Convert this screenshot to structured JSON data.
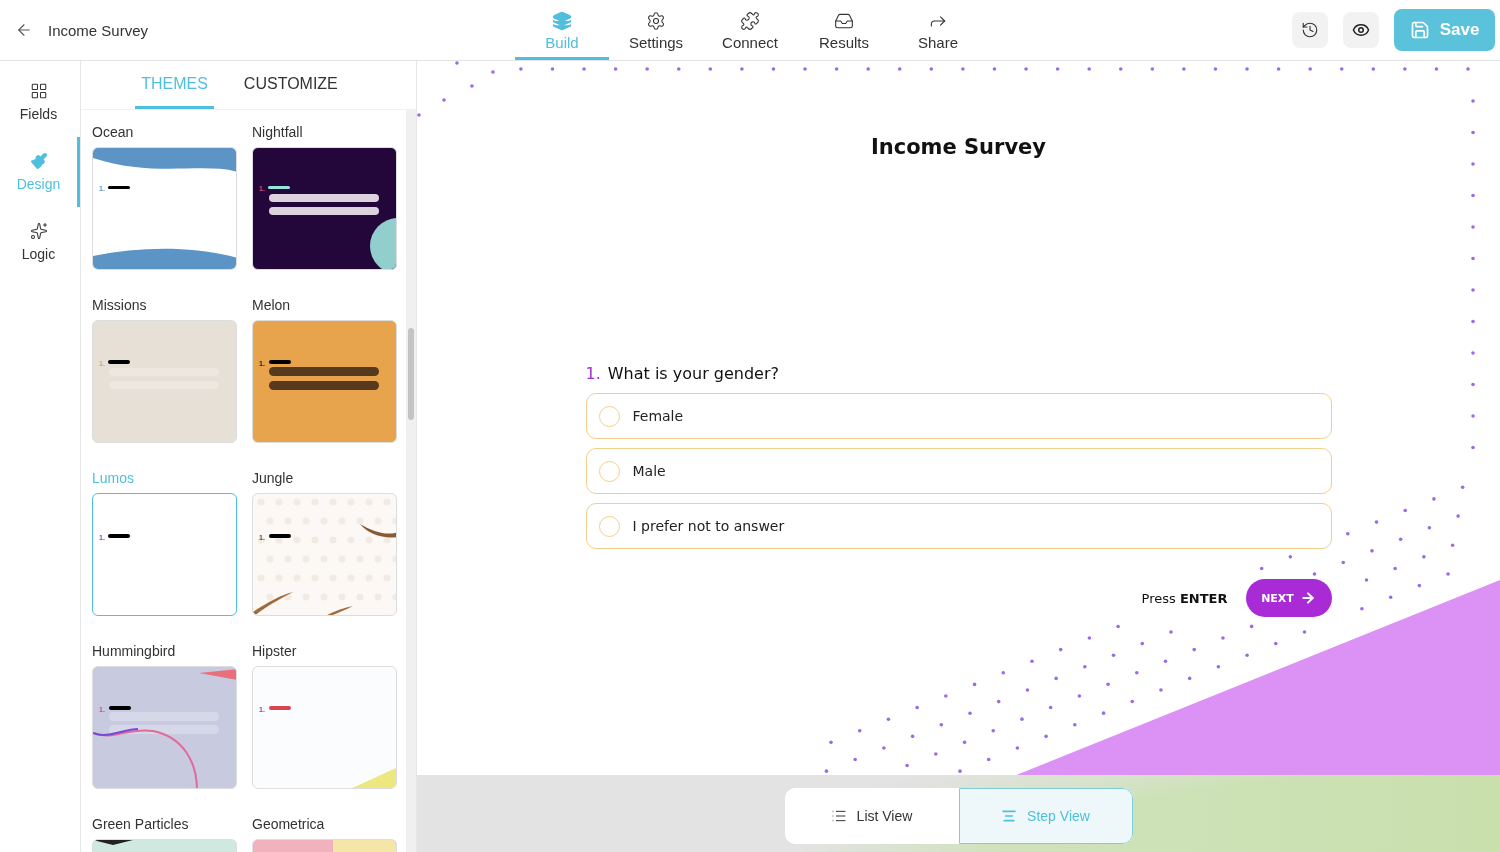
{
  "topbar": {
    "title": "Income Survey",
    "save_label": "Save"
  },
  "nav_tabs": [
    {
      "label": "Build",
      "selected": true
    },
    {
      "label": "Settings",
      "selected": false
    },
    {
      "label": "Connect",
      "selected": false
    },
    {
      "label": "Results",
      "selected": false
    },
    {
      "label": "Share",
      "selected": false
    }
  ],
  "sidebar": {
    "items": [
      {
        "label": "Fields",
        "selected": false
      },
      {
        "label": "Design",
        "selected": true
      },
      {
        "label": "Logic",
        "selected": false
      }
    ]
  },
  "panel_tabs": [
    {
      "label": "THEMES",
      "selected": true
    },
    {
      "label": "CUSTOMIZE",
      "selected": false
    }
  ],
  "themes": [
    {
      "name": "Ocean",
      "kind": "ocean",
      "mark": "1.",
      "selected": false
    },
    {
      "name": "Nightfall",
      "kind": "nightfall",
      "mark": "1.",
      "selected": false
    },
    {
      "name": "Missions",
      "kind": "missions",
      "mark": "1.",
      "selected": false
    },
    {
      "name": "Melon",
      "kind": "melon",
      "mark": "1.",
      "selected": false
    },
    {
      "name": "Lumos",
      "kind": "lumos",
      "mark": "1.",
      "selected": true
    },
    {
      "name": "Jungle",
      "kind": "jungle",
      "mark": "1.",
      "selected": false
    },
    {
      "name": "Hummingbird",
      "kind": "hummingbird",
      "mark": "1.",
      "selected": false
    },
    {
      "name": "Hipster",
      "kind": "hipster",
      "mark": "1.",
      "selected": false
    },
    {
      "name": "Green Particles",
      "kind": "particles",
      "selected": false
    },
    {
      "name": "Geometrica",
      "kind": "geometrica",
      "selected": false
    }
  ],
  "preview": {
    "title": "Income Survey",
    "question": {
      "number": "1.",
      "text": "What is your gender?",
      "options": [
        {
          "label": "Female",
          "selected": false
        },
        {
          "label": "Male",
          "selected": false
        },
        {
          "label": "I prefer not to answer",
          "selected": false
        }
      ]
    },
    "hint": "Press **ENTER**",
    "next_label": "NEXT"
  },
  "views": [
    {
      "label": "List View",
      "selected": false
    },
    {
      "label": "Step View",
      "selected": true
    }
  ]
}
